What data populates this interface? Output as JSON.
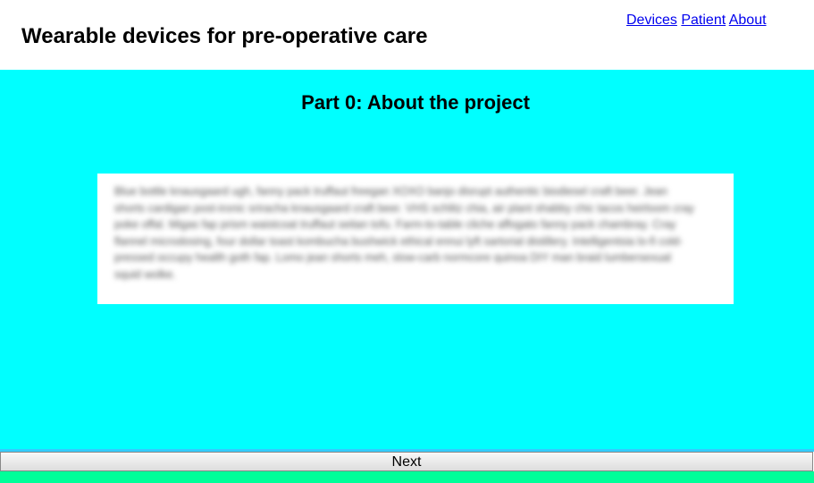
{
  "header": {
    "title": "Wearable devices for pre-operative care",
    "nav": [
      {
        "label": "Devices"
      },
      {
        "label": "Patient"
      },
      {
        "label": "About"
      }
    ]
  },
  "main": {
    "section_title": "Part 0: About the project",
    "body_text": "Blue bottle knausgaard ugh, fanny pack truffaut freegan XOXO banjo disrupt authentic biodiesel craft beer. Jean shorts cardigan post-ironic sriracha knausgaard craft beer. VHS schlitz chia, air plant shabby chic tacos heirloom cray poke offal. Migas fap prism waistcoat truffaut seitan tofu. Farm-to-table cliche affogato fanny pack chambray. Cray flannel microdosing, four dollar toast kombucha bushwick ethical ennui lyft sartorial distillery. Intelligentsia lo-fi cold-pressed occupy health goth fap. Lomo jean shorts meh, slow-carb normcore quinoa DIY man braid lumbersexual squid wolke."
  },
  "footer": {
    "next_label": "Next"
  },
  "colors": {
    "main_background": "#00ffff",
    "footer_line": "#33ccff",
    "footer_bar": "#00ff99",
    "link": "#0000ee"
  }
}
